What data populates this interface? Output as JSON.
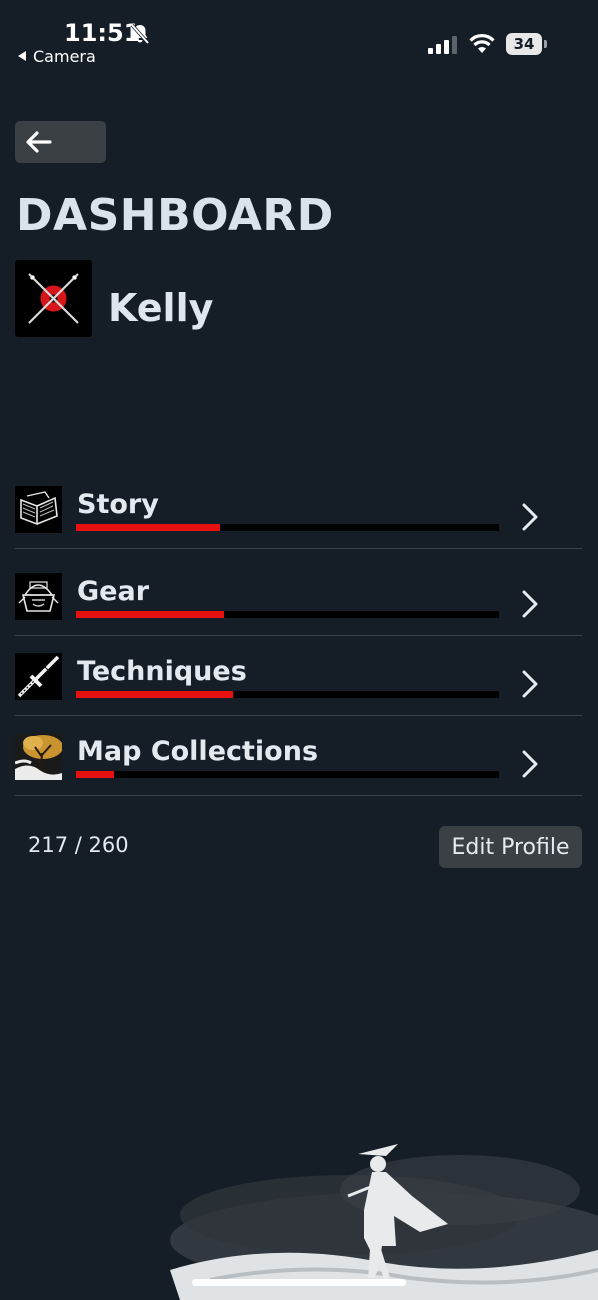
{
  "status_bar": {
    "time": "11:51",
    "back_app_label": "Camera",
    "battery_level": "34"
  },
  "header": {
    "title": "DASHBOARD"
  },
  "profile": {
    "name": "Kelly",
    "avatar_icon": "crossed-katanas-red-sun-icon"
  },
  "categories": [
    {
      "label": "Story",
      "icon": "open-book-icon",
      "progress": 0.34
    },
    {
      "label": "Gear",
      "icon": "samurai-helmet-icon",
      "progress": 0.35
    },
    {
      "label": "Techniques",
      "icon": "katana-icon",
      "progress": 0.37
    },
    {
      "label": "Map Collections",
      "icon": "golden-tree-icon",
      "progress": 0.09
    }
  ],
  "footer": {
    "progress_text": "217 / 260",
    "edit_profile_label": "Edit Profile"
  },
  "colors": {
    "background": "#151e27",
    "accent_red": "#e8100f",
    "button_bg": "#3b4045"
  }
}
